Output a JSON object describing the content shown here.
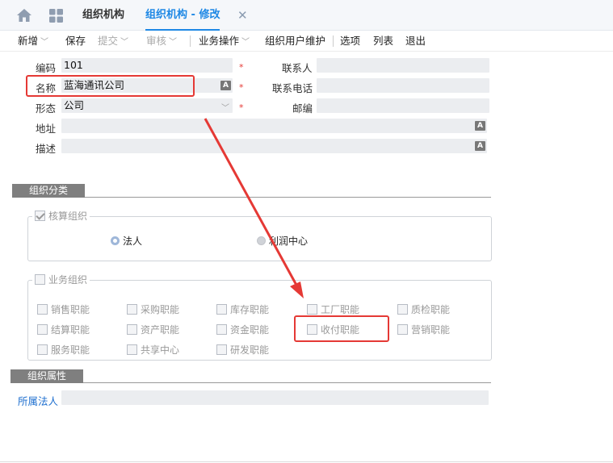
{
  "tabs": [
    {
      "label": "组织机构"
    },
    {
      "label": "组织机构 - 修改"
    }
  ],
  "tab_close": "✕",
  "toolbar": {
    "new": "新增",
    "save": "保存",
    "submit": "提交",
    "audit": "审核",
    "business_ops": "业务操作",
    "org_user_maint": "组织用户维护",
    "options": "选项",
    "list": "列表",
    "exit": "退出"
  },
  "form": {
    "code_label": "编码",
    "code_value": "101",
    "name_label": "名称",
    "name_value": "蓝海通讯公司",
    "form_label": "形态",
    "form_value": "公司",
    "address_label": "地址",
    "address_value": "",
    "desc_label": "描述",
    "desc_value": "",
    "contact_label": "联系人",
    "contact_value": "",
    "phone_label": "联系电话",
    "phone_value": "",
    "postcode_label": "邮编",
    "postcode_value": "",
    "required_mark": "*",
    "lang_icon": "A"
  },
  "org_category": {
    "title": "组织分类",
    "accounting_org": {
      "legend": "核算组织",
      "checked": true,
      "options": [
        {
          "label": "法人",
          "selected": true
        },
        {
          "label": "利润中心",
          "selected": false
        }
      ]
    },
    "business_org": {
      "legend": "业务组织",
      "checked": false,
      "functions": [
        [
          "销售职能",
          "采购职能",
          "库存职能",
          "工厂职能",
          "质检职能"
        ],
        [
          "结算职能",
          "资产职能",
          "资金职能",
          "收付职能",
          "营销职能"
        ],
        [
          "服务职能",
          "共享中心",
          "研发职能"
        ]
      ]
    }
  },
  "org_attributes": {
    "title": "组织属性",
    "legal_entity_label": "所属法人",
    "legal_entity_value": ""
  },
  "colors": {
    "accent": "#1e88e5",
    "highlight": "#e53935",
    "section": "#7f7f7f"
  }
}
